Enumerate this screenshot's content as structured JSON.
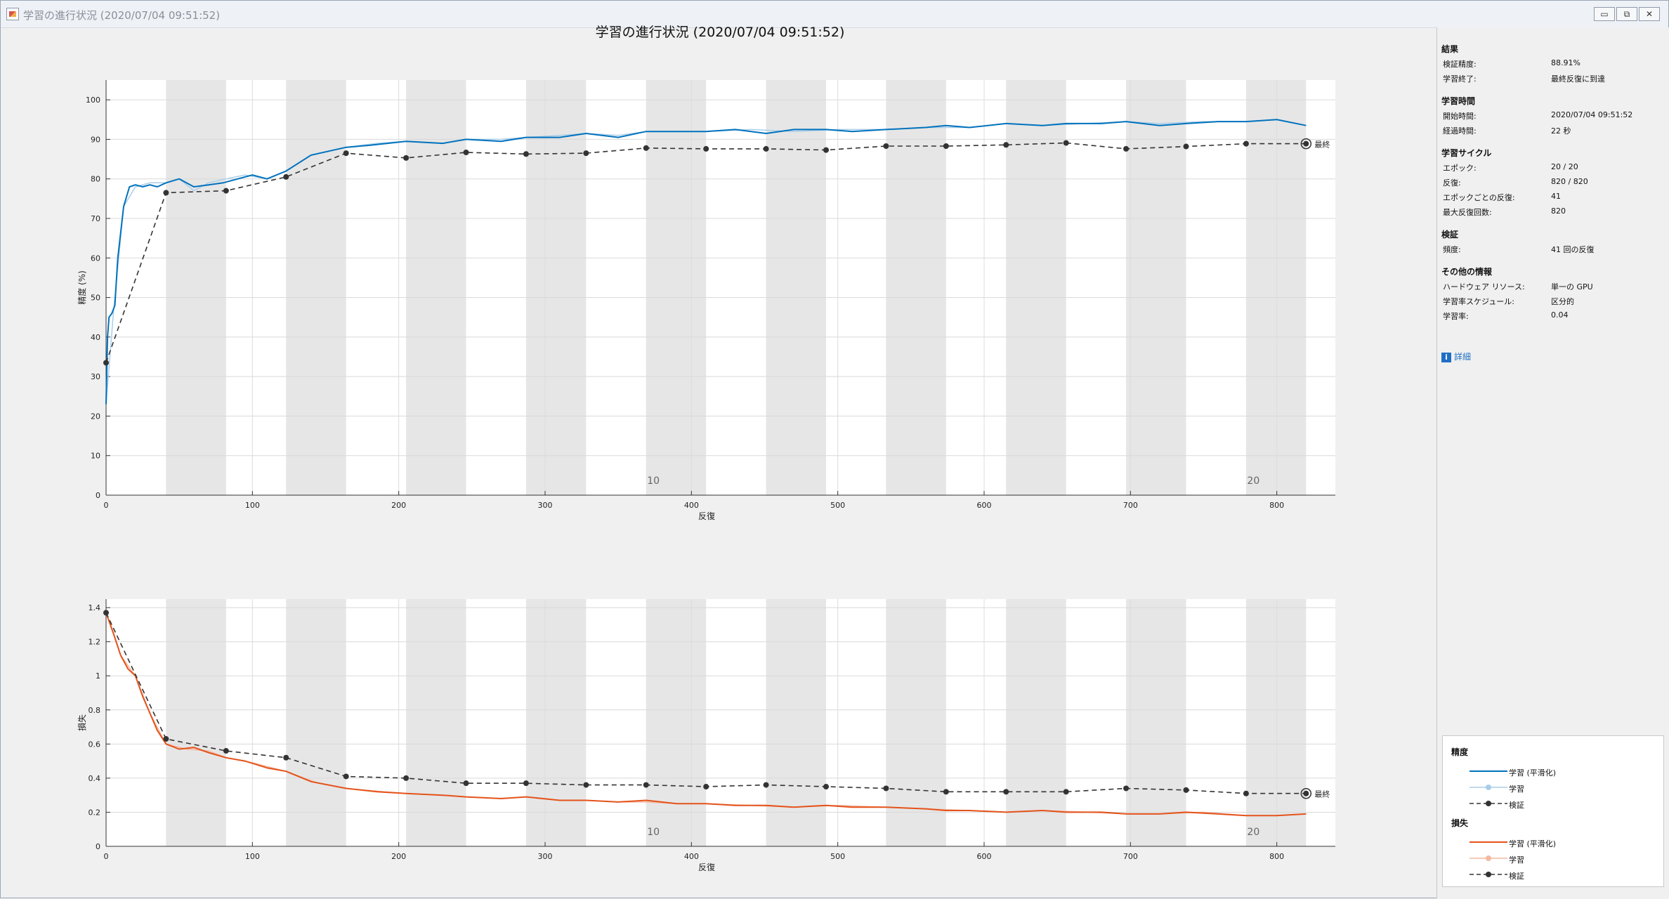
{
  "window": {
    "title": "学習の進行状況 (2020/07/04 09:51:52)",
    "buttons": [
      "▭",
      "⧉",
      "✕"
    ]
  },
  "main_title": "学習の進行状況 (2020/07/04 09:51:52)",
  "final_label": "最終",
  "side_panel": {
    "sections": [
      {
        "header": "結果",
        "rows": [
          {
            "k": "検証精度:",
            "v": "88.91%"
          },
          {
            "k": "学習終了:",
            "v": "最終反復に到達"
          }
        ]
      },
      {
        "header": "学習時間",
        "rows": [
          {
            "k": "開始時間:",
            "v": "2020/07/04 09:51:52"
          },
          {
            "k": "経過時間:",
            "v": "22 秒"
          }
        ]
      },
      {
        "header": "学習サイクル",
        "rows": [
          {
            "k": "エポック:",
            "v": "20 / 20"
          },
          {
            "k": "反復:",
            "v": "820 / 820"
          },
          {
            "k": "エポックごとの反復:",
            "v": "41"
          },
          {
            "k": "最大反復回数:",
            "v": "820"
          }
        ]
      },
      {
        "header": "検証",
        "rows": [
          {
            "k": "頻度:",
            "v": "41 回の反復"
          }
        ]
      },
      {
        "header": "その他の情報",
        "rows": [
          {
            "k": "ハードウェア リソース:",
            "v": "単一の GPU"
          },
          {
            "k": "学習率スケジュール:",
            "v": "区分的"
          },
          {
            "k": "学習率:",
            "v": "0.04"
          }
        ]
      }
    ],
    "details_label": "詳細",
    "details_icon": "info-icon"
  },
  "legend": {
    "groups": [
      {
        "header": "精度",
        "items": [
          "学習 (平滑化)",
          "学習",
          "検証"
        ]
      },
      {
        "header": "損失",
        "items": [
          "学習 (平滑化)",
          "学習",
          "検証"
        ]
      }
    ]
  },
  "colors": {
    "acc_smooth": "#0072bd",
    "acc_raw": "#a9cde8",
    "loss_smooth": "#e4531b",
    "loss_raw": "#f4b8a0",
    "validation": "#333333",
    "epoch_band": "#e6e6e6"
  },
  "chart_data": [
    {
      "type": "line",
      "xlabel": "反復",
      "ylabel": "精度 (%)",
      "xlim": [
        0,
        840
      ],
      "ylim": [
        0,
        105
      ],
      "xticks": [
        0,
        100,
        200,
        300,
        400,
        500,
        600,
        700,
        800
      ],
      "yticks": [
        0,
        10,
        20,
        30,
        40,
        50,
        60,
        70,
        80,
        90,
        100
      ],
      "epoch_labels": [
        {
          "epoch": "10",
          "x": 374
        },
        {
          "epoch": "20",
          "x": 784
        }
      ],
      "iterations_per_epoch": 41,
      "series": [
        {
          "name": "学習 (平滑化)",
          "x": [
            0,
            1,
            2,
            4,
            6,
            8,
            12,
            16,
            20,
            25,
            30,
            35,
            41,
            50,
            60,
            70,
            80,
            90,
            100,
            110,
            123,
            140,
            164,
            180,
            205,
            230,
            246,
            270,
            287,
            310,
            328,
            350,
            369,
            390,
            410,
            430,
            451,
            470,
            492,
            510,
            533,
            560,
            574,
            590,
            615,
            640,
            656,
            680,
            697,
            720,
            738,
            760,
            779,
            800,
            820
          ],
          "y": [
            23,
            40,
            45,
            46,
            48,
            60,
            73,
            78,
            78.5,
            78,
            78.5,
            78,
            79,
            80,
            78,
            78.5,
            79,
            80,
            81,
            80,
            82,
            86,
            88,
            88.5,
            89.5,
            89,
            90,
            89.5,
            90.5,
            90.5,
            91.5,
            90.5,
            92,
            92,
            92,
            92.5,
            91.5,
            92.5,
            92.5,
            92,
            92.5,
            93,
            93.5,
            93,
            94,
            93.5,
            94,
            94,
            94.5,
            93.5,
            94,
            94.5,
            94.5,
            95,
            93.5
          ]
        },
        {
          "name": "学習",
          "x": [
            0,
            5,
            12,
            20,
            30,
            41,
            50,
            60,
            70,
            82,
            95,
            110,
            123,
            140,
            164,
            185,
            205,
            230,
            246,
            270,
            287,
            310,
            328,
            350,
            369,
            390,
            410,
            440,
            470,
            500,
            533,
            560,
            590,
            615,
            640,
            670,
            697,
            720,
            750,
            779,
            800,
            820
          ],
          "y": [
            23,
            46,
            73,
            78,
            79,
            79,
            80,
            77,
            79,
            80,
            81,
            80,
            82,
            86,
            88,
            89,
            89.5,
            89,
            90,
            90,
            90.5,
            91,
            91.5,
            91,
            92,
            92,
            92,
            92.5,
            92,
            92.5,
            92.5,
            93,
            93,
            94,
            93.5,
            94,
            94.5,
            94,
            94.5,
            94.5,
            95,
            93.5
          ]
        },
        {
          "name": "検証",
          "x": [
            0,
            41,
            82,
            123,
            164,
            205,
            246,
            287,
            328,
            369,
            410,
            451,
            492,
            533,
            574,
            615,
            656,
            697,
            738,
            779,
            820
          ],
          "y": [
            33.5,
            76.5,
            77,
            80.5,
            86.5,
            85.3,
            86.7,
            86.3,
            86.5,
            87.8,
            87.6,
            87.6,
            87.3,
            88.3,
            88.3,
            88.6,
            89.1,
            87.6,
            88.2,
            88.9,
            88.9
          ]
        }
      ]
    },
    {
      "type": "line",
      "xlabel": "反復",
      "ylabel": "損失",
      "xlim": [
        0,
        840
      ],
      "ylim": [
        0,
        1.45
      ],
      "xticks": [
        0,
        100,
        200,
        300,
        400,
        500,
        600,
        700,
        800
      ],
      "yticks": [
        0,
        0.2,
        0.4,
        0.6,
        0.8,
        1,
        1.2,
        1.4
      ],
      "epoch_labels": [
        {
          "epoch": "10",
          "x": 374
        },
        {
          "epoch": "20",
          "x": 784
        }
      ],
      "iterations_per_epoch": 41,
      "series": [
        {
          "name": "学習 (平滑化)",
          "x": [
            0,
            5,
            10,
            15,
            20,
            25,
            30,
            35,
            41,
            50,
            60,
            70,
            82,
            95,
            110,
            123,
            140,
            164,
            185,
            205,
            230,
            246,
            270,
            287,
            310,
            328,
            350,
            369,
            390,
            410,
            430,
            451,
            470,
            492,
            510,
            533,
            560,
            574,
            590,
            615,
            640,
            656,
            680,
            697,
            720,
            738,
            760,
            779,
            800,
            820
          ],
          "y": [
            1.37,
            1.25,
            1.12,
            1.04,
            1.0,
            0.88,
            0.78,
            0.68,
            0.6,
            0.57,
            0.58,
            0.55,
            0.52,
            0.5,
            0.46,
            0.44,
            0.38,
            0.34,
            0.32,
            0.31,
            0.3,
            0.29,
            0.28,
            0.29,
            0.27,
            0.27,
            0.26,
            0.27,
            0.25,
            0.25,
            0.24,
            0.24,
            0.23,
            0.24,
            0.23,
            0.23,
            0.22,
            0.21,
            0.21,
            0.2,
            0.21,
            0.2,
            0.2,
            0.19,
            0.19,
            0.2,
            0.19,
            0.18,
            0.18,
            0.19
          ]
        },
        {
          "name": "学習",
          "x": [
            0,
            10,
            20,
            30,
            41,
            55,
            70,
            82,
            100,
            123,
            145,
            164,
            190,
            205,
            230,
            246,
            270,
            287,
            310,
            328,
            350,
            369,
            390,
            410,
            440,
            470,
            500,
            533,
            560,
            590,
            615,
            640,
            670,
            697,
            720,
            750,
            779,
            800,
            820
          ],
          "y": [
            1.37,
            1.12,
            1.0,
            0.78,
            0.6,
            0.57,
            0.56,
            0.52,
            0.49,
            0.44,
            0.37,
            0.34,
            0.32,
            0.31,
            0.3,
            0.29,
            0.28,
            0.29,
            0.27,
            0.27,
            0.26,
            0.26,
            0.25,
            0.25,
            0.24,
            0.23,
            0.24,
            0.23,
            0.22,
            0.21,
            0.2,
            0.21,
            0.2,
            0.19,
            0.19,
            0.2,
            0.18,
            0.18,
            0.19
          ]
        },
        {
          "name": "検証",
          "x": [
            0,
            41,
            82,
            123,
            164,
            205,
            246,
            287,
            328,
            369,
            410,
            451,
            492,
            533,
            574,
            615,
            656,
            697,
            738,
            779,
            820
          ],
          "y": [
            1.37,
            0.63,
            0.56,
            0.52,
            0.41,
            0.4,
            0.37,
            0.37,
            0.36,
            0.36,
            0.35,
            0.36,
            0.35,
            0.34,
            0.32,
            0.32,
            0.32,
            0.34,
            0.33,
            0.31,
            0.31
          ]
        }
      ]
    }
  ]
}
